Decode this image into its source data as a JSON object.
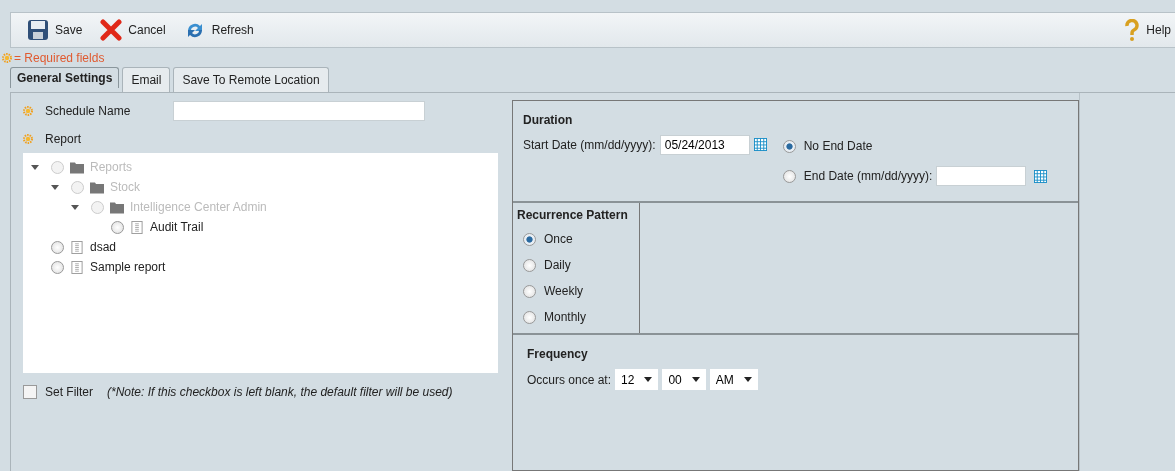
{
  "toolbar": {
    "buttons": [
      {
        "label": "Save",
        "kind": "save"
      },
      {
        "label": "Cancel",
        "kind": "cancel"
      },
      {
        "label": "Refresh",
        "kind": "refresh"
      }
    ],
    "help": "Help"
  },
  "required_note": "= Required fields",
  "tabs": [
    {
      "label": "General Settings",
      "selected": true
    },
    {
      "label": "Email",
      "selected": false
    },
    {
      "label": "Save To Remote Location",
      "selected": false
    }
  ],
  "schedule_name": {
    "label": "Schedule Name",
    "required": true
  },
  "report": {
    "label": "Report",
    "required": true
  },
  "tree": [
    {
      "label": "Reports",
      "kind": "folder",
      "disabled": true,
      "expanded": true,
      "selected": false,
      "children": [
        {
          "label": "Stock",
          "kind": "folder",
          "disabled": true,
          "expanded": true,
          "selected": false,
          "children": [
            {
              "label": "Intelligence Center Admin",
              "kind": "folder",
              "disabled": true,
              "expanded": true,
              "selected": false,
              "children": [
                {
                  "label": "Audit Trail",
                  "kind": "report",
                  "disabled": false,
                  "selected": false
                }
              ]
            }
          ]
        }
      ]
    },
    {
      "label": "dsad",
      "kind": "report",
      "disabled": false,
      "selected": false
    },
    {
      "label": "Sample report",
      "kind": "report",
      "disabled": false,
      "selected": false
    }
  ],
  "set_filter": {
    "label": "Set Filter",
    "checked": false,
    "note": "(*Note: If this checkbox is left blank, the default filter will be used)"
  },
  "duration": {
    "title": "Duration",
    "start_label": "Start Date (mm/dd/yyyy):",
    "start_value": "05/24/2013",
    "options": [
      {
        "label": "No End Date",
        "selected": true
      },
      {
        "label": "End Date (mm/dd/yyyy):",
        "selected": false
      }
    ]
  },
  "recurrence": {
    "title": "Recurrence Pattern",
    "options": [
      {
        "label": "Once",
        "selected": true
      },
      {
        "label": "Daily",
        "selected": false
      },
      {
        "label": "Weekly",
        "selected": false
      },
      {
        "label": "Monthly",
        "selected": false
      }
    ]
  },
  "frequency": {
    "title": "Frequency",
    "label": "Occurs once at:",
    "selects": [
      "12",
      "00",
      "AM"
    ]
  }
}
